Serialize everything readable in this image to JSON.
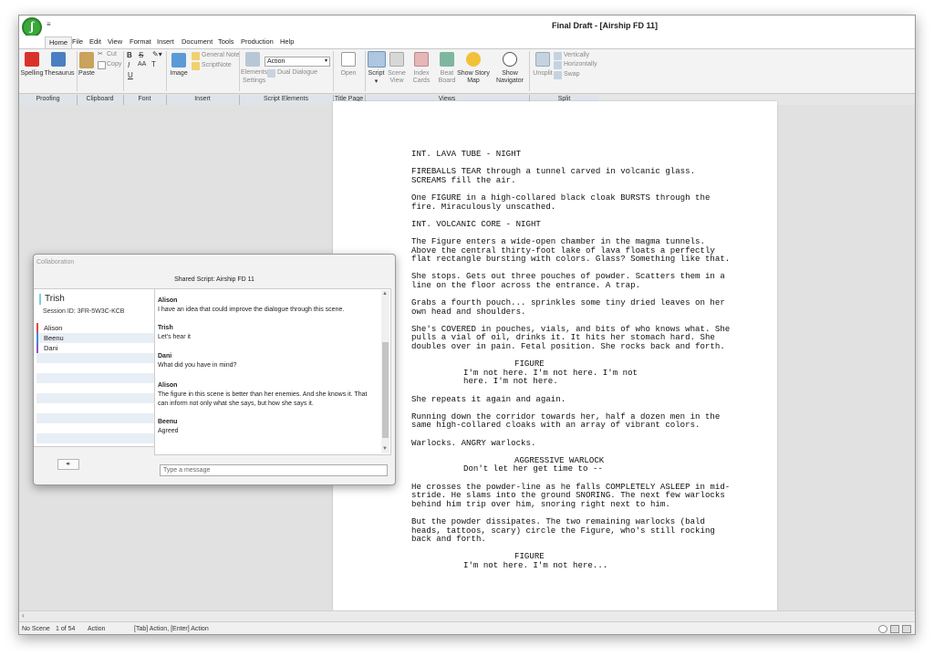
{
  "window": {
    "title": "Final Draft - [Airship FD 11]",
    "qa_toolbar": "≡"
  },
  "menu": [
    "Home",
    "File",
    "Edit",
    "View",
    "Format",
    "Insert",
    "Document",
    "Tools",
    "Production",
    "Help"
  ],
  "ribbon": {
    "spelling": "Spelling",
    "thesaurus": "Thesaurus",
    "paste": "Paste",
    "cut": "Cut",
    "copy": "Copy",
    "font_bold": "B",
    "font_strike": "S",
    "font_italic": "I",
    "font_aa": "AA",
    "font_t": "T",
    "font_underline": "U",
    "image": "Image",
    "general_note": "General Note",
    "script_note": "ScriptNote",
    "elements": "Elements",
    "settings": "Settings",
    "element_value": "Action",
    "dual_dialogue": "Dual Dialogue",
    "open": "Open",
    "script": "Script",
    "scene": "Scene",
    "view": "View",
    "index": "Index",
    "cards": "Cards",
    "beat": "Beat",
    "board": "Board",
    "show_story": "Show Story",
    "map": "Map",
    "show": "Show",
    "navigator": "Navigator",
    "unsplit": "Unsplit",
    "vertically": "Vertically",
    "horizontally": "Horizontally",
    "swap": "Swap"
  },
  "groups": [
    "Proofing",
    "Clipboard",
    "Font",
    "Insert",
    "Script Elements",
    "Title Page",
    "Views",
    "Split"
  ],
  "script": [
    {
      "type": "heading",
      "text": "INT. LAVA TUBE - NIGHT"
    },
    {
      "type": "action",
      "text": "FIREBALLS TEAR through a tunnel carved in volcanic glass. SCREAMS fill the air."
    },
    {
      "type": "action",
      "text": "One FIGURE in a high-collared black cloak BURSTS through the fire. Miraculously unscathed."
    },
    {
      "type": "heading",
      "text": "INT. VOLCANIC CORE - NIGHT"
    },
    {
      "type": "action",
      "text": "The Figure enters a wide-open chamber in the magma tunnels. Above the central thirty-foot lake of lava floats a perfectly flat rectangle bursting with colors. Glass? Something like that."
    },
    {
      "type": "action",
      "text": "She stops. Gets out three pouches of powder. Scatters them in a line on the floor across the entrance. A trap."
    },
    {
      "type": "action",
      "text": "Grabs a fourth pouch... sprinkles some tiny dried leaves on her own head and shoulders."
    },
    {
      "type": "action",
      "text": "She's COVERED in pouches, vials, and bits of who knows what. She pulls a vial of oil, drinks it. It hits her stomach hard. She doubles over in pain. Fetal position. She rocks back and forth."
    },
    {
      "type": "character",
      "text": "FIGURE"
    },
    {
      "type": "dialogue",
      "text": "I'm not here. I'm not here. I'm not here. I'm not here."
    },
    {
      "type": "action",
      "text": "She repeats it again and again."
    },
    {
      "type": "action",
      "text": "Running down the corridor towards her, half a dozen men in the same high-collared cloaks with an array of vibrant colors."
    },
    {
      "type": "action",
      "text": "Warlocks. ANGRY warlocks."
    },
    {
      "type": "character",
      "text": "AGGRESSIVE WARLOCK"
    },
    {
      "type": "dialogue",
      "text": "Don't let her get time to --"
    },
    {
      "type": "action",
      "text": "He crosses the powder-line as he falls COMPLETELY ASLEEP in mid-stride. He slams into the ground SNORING. The next few warlocks behind him trip over him, snoring right next to him."
    },
    {
      "type": "action",
      "text": "But the powder dissipates. The two remaining warlocks (bald heads, tattoos, scary) circle the Figure, who's still rocking back and forth."
    },
    {
      "type": "character",
      "text": "FIGURE"
    },
    {
      "type": "dialogue",
      "text": "I'm not here. I'm not here..."
    }
  ],
  "collaboration": {
    "title": "Collaboration",
    "shared_script": "Shared Script: Airship FD 11",
    "me": "Trish",
    "session_id": "Session ID: 3FR-5W3C-KCB",
    "users": [
      "Alison",
      "Beenu",
      "Dani"
    ],
    "messages": [
      {
        "who": "Alison",
        "text": "I have an idea that could improve the dialogue through this scene."
      },
      {
        "who": "Trish",
        "text": "Let's hear it"
      },
      {
        "who": "Dani",
        "text": "What did you have in mind?"
      },
      {
        "who": "Alison",
        "text": "The figure in this scene is better than her enemies. And she knows it. That can inform not only what she says, but how she says it."
      },
      {
        "who": "Beenu",
        "text": "Agreed"
      }
    ],
    "input_placeholder": "Type a message",
    "speaker_icon": "◂·"
  },
  "status": {
    "scene": "No Scene",
    "page": "1 of 54",
    "element": "Action",
    "hint": "[Tab] Action, [Enter] Action"
  },
  "colors": {
    "accent": "#3aa83a",
    "group_bar": "#dfe4ea",
    "user_highlight": "#7ad0e0"
  }
}
